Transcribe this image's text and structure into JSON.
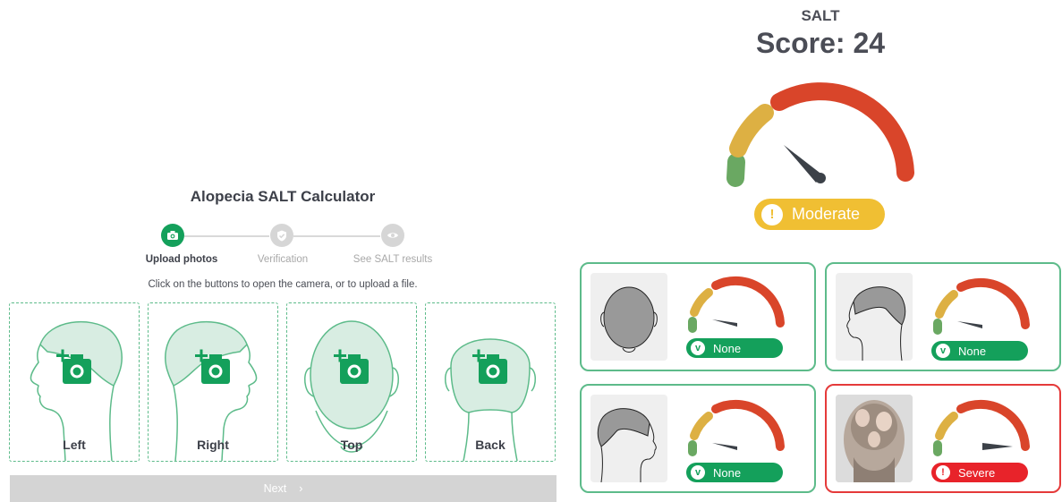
{
  "app": {
    "title": "Alopecia SALT Calculator",
    "steps": [
      {
        "label": "Upload photos",
        "state": "active",
        "icon": "camera-icon"
      },
      {
        "label": "Verification",
        "state": "inactive",
        "icon": "shield-check-icon"
      },
      {
        "label": "See SALT results",
        "state": "inactive",
        "icon": "eye-icon"
      }
    ],
    "instruction": "Click on the buttons to open the camera, or to upload a file.",
    "cards": [
      {
        "label": "Left",
        "view": "left-profile"
      },
      {
        "label": "Right",
        "view": "right-profile"
      },
      {
        "label": "Top",
        "view": "top"
      },
      {
        "label": "Back",
        "view": "back"
      }
    ],
    "next_label": "Next",
    "next_icon": "chevron-right-icon"
  },
  "results": {
    "salt_label": "SALT",
    "score_text": "Score: 24",
    "score_value": 24,
    "severity_label": "Moderate",
    "severity_color": "#f0bf33",
    "views": [
      {
        "severity": "None",
        "status": "none"
      },
      {
        "severity": "None",
        "status": "none"
      },
      {
        "severity": "None",
        "status": "none"
      },
      {
        "severity": "Severe",
        "status": "severe"
      }
    ]
  },
  "colors": {
    "accent_green": "#14a05b",
    "gauge_green": "#6aa862",
    "gauge_yellow": "#ddb043",
    "gauge_red": "#d9452a",
    "severe_red": "#e8232a",
    "moderate_yellow": "#f0bf33"
  }
}
